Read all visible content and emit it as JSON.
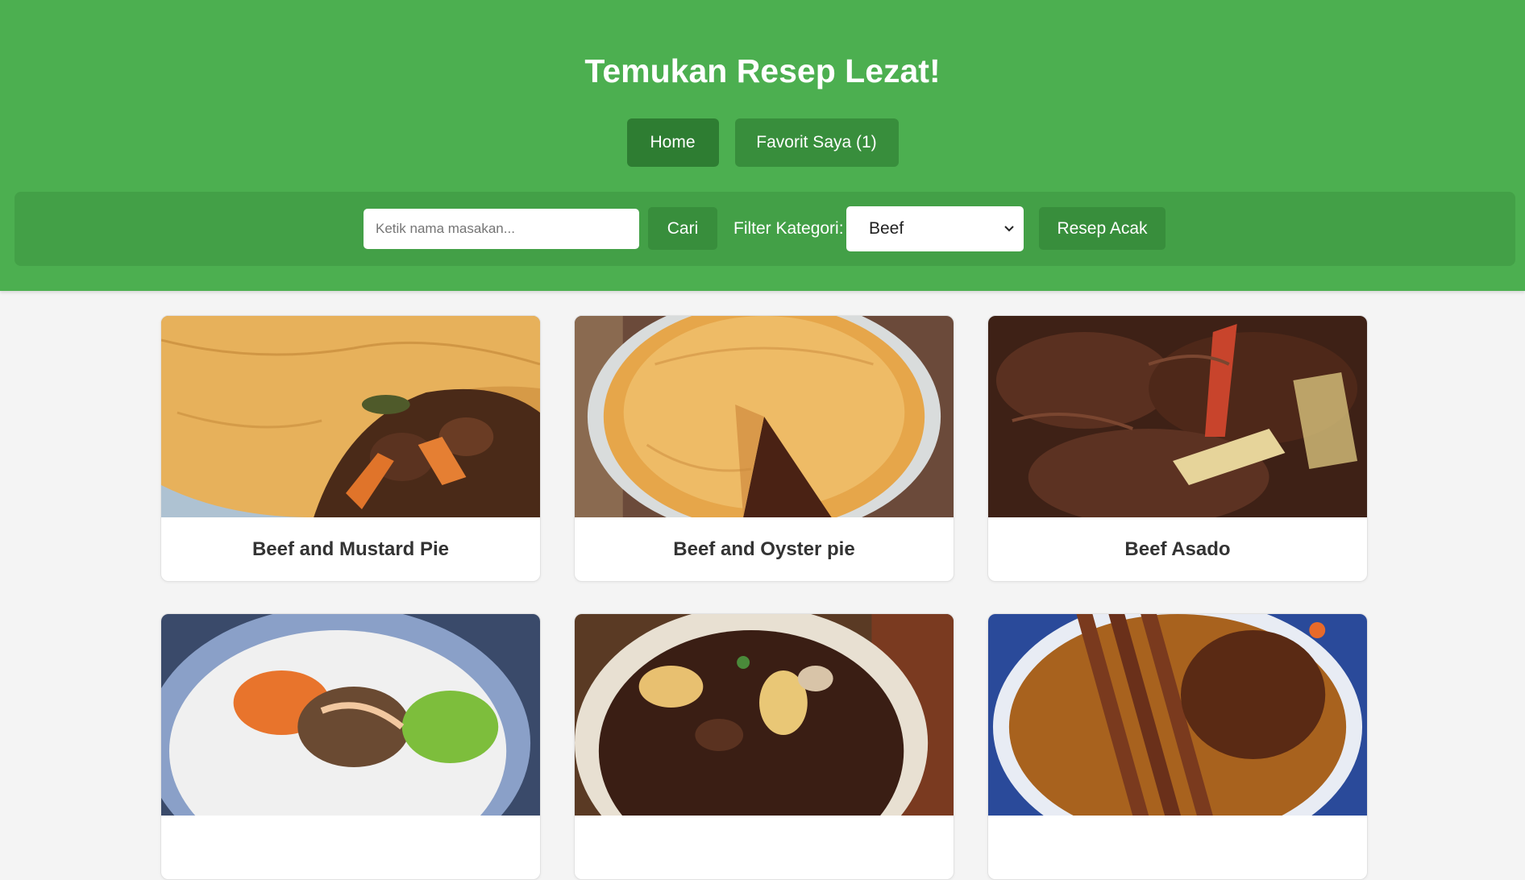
{
  "header": {
    "title": "Temukan Resep Lezat!",
    "nav": [
      {
        "label": "Home",
        "active": true
      },
      {
        "label": "Favorit Saya (1)",
        "active": false
      }
    ]
  },
  "toolbar": {
    "search_placeholder": "Ketik nama masakan...",
    "search_value": "",
    "search_button": "Cari",
    "filter_label": "Filter Kategori:",
    "filter_selected": "Beef",
    "random_button": "Resep Acak"
  },
  "recipes": [
    {
      "title": "Beef and Mustard Pie",
      "image": "beef-mustard-pie-photo"
    },
    {
      "title": "Beef and Oyster pie",
      "image": "beef-oyster-pie-photo"
    },
    {
      "title": "Beef Asado",
      "image": "beef-asado-photo"
    },
    {
      "title": "",
      "image": "beef-rice-bowl-photo"
    },
    {
      "title": "",
      "image": "beef-stew-casserole-photo"
    },
    {
      "title": "",
      "image": "sliced-roast-beef-photo"
    }
  ],
  "colors": {
    "header_bg": "#4caf50",
    "toolbar_bg": "#43a047",
    "button_bg": "#388e3c",
    "button_active_bg": "#2e7d32",
    "page_bg": "#f4f4f4"
  }
}
